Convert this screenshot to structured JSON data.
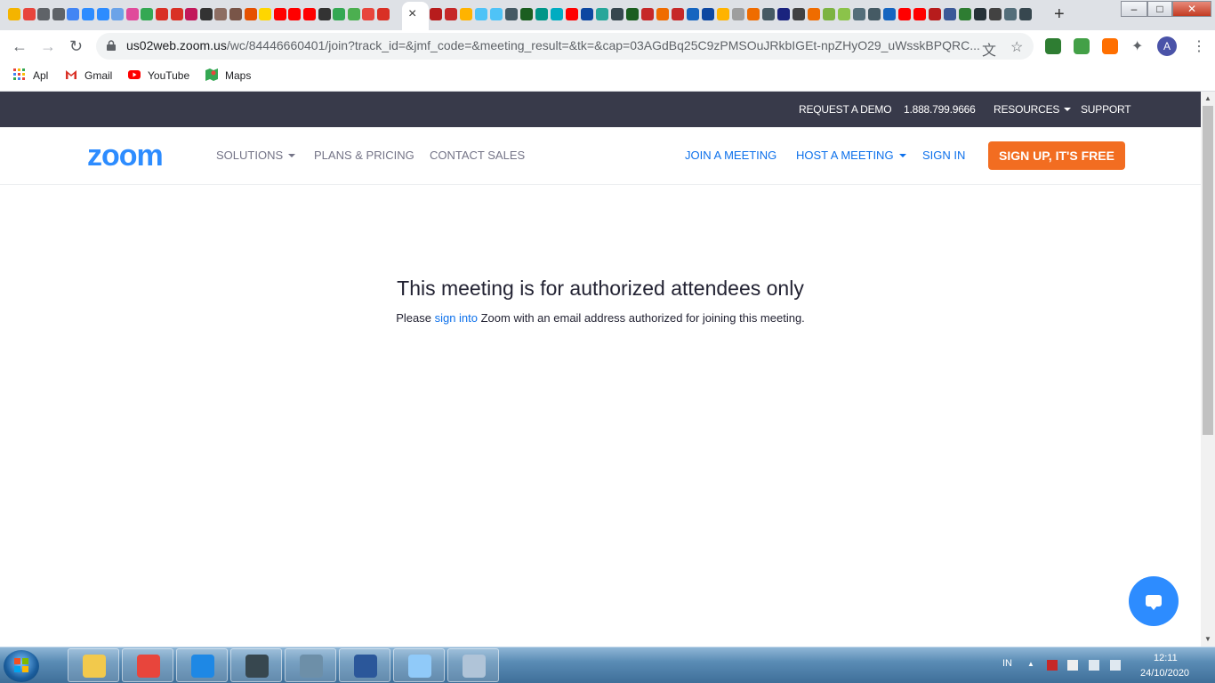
{
  "browser": {
    "tab_close": "×",
    "new_tab": "+",
    "window_controls": {
      "minimize": "‒",
      "maximize": "□",
      "close": "✕"
    },
    "nav": {
      "back": "←",
      "forward": "→",
      "reload": "↻"
    },
    "url_host": "us02web.zoom.us",
    "url_path": "/wc/84446660401/join?track_id=&jmf_code=&meeting_result=&tk=&cap=03AGdBq25C9zPMSOuJRkbIGEt-npZHyO29_uWsskBPQRC...",
    "profile_initial": "A",
    "menu": "⋮",
    "translate_icon": "文",
    "star_icon": "☆",
    "extensions_icon": "✦",
    "bookmarks": [
      {
        "label": "Apl",
        "color": "#e8453c"
      },
      {
        "label": "Gmail",
        "color": "#d93025"
      },
      {
        "label": "YouTube",
        "color": "#ff0000"
      },
      {
        "label": "Maps",
        "color": "#34a853"
      }
    ],
    "tab_icon_colors": [
      "#f4b400",
      "#e8453c",
      "#5f6368",
      "#5f6368",
      "#4285f4",
      "#2d8cff",
      "#2d8cff",
      "#6ba3e8",
      "#e04b9b",
      "#34a853",
      "#d93025",
      "#d93025",
      "#c2185b",
      "#333333",
      "#8d6e63",
      "#795548",
      "#e65100",
      "#ffd600",
      "#ff0000",
      "#ff0000",
      "#ff0000",
      "#333333",
      "#34a853",
      "#4caf50",
      "#e8453c",
      "#d93025"
    ],
    "tab_icon_colors_right": [
      "#b71c1c",
      "#c62828",
      "#ffb300",
      "#4fc3f7",
      "#4fc3f7",
      "#455a64",
      "#1b5e20",
      "#009688",
      "#00acc1",
      "#ff0000",
      "#0d47a1",
      "#26a69a",
      "#37474f",
      "#1b5e20",
      "#c62828",
      "#ef6c00",
      "#c62828",
      "#1565c0",
      "#0d47a1",
      "#ffb300",
      "#9e9e9e",
      "#ef6c00",
      "#455a64",
      "#1a237e",
      "#424242",
      "#ef6c00",
      "#7cb342",
      "#8bc34a",
      "#546e7a",
      "#455a64",
      "#1565c0",
      "#ff0000",
      "#ff0000",
      "#b71c1c",
      "#3b5998",
      "#2e7d32",
      "#263238",
      "#424242",
      "#546e7a",
      "#37474f"
    ],
    "ext_colors": [
      "#2e7d32",
      "#43a047",
      "#ff6f00"
    ]
  },
  "zoom": {
    "topbar": {
      "request_demo": "REQUEST A DEMO",
      "phone": "1.888.799.9666",
      "resources": "RESOURCES",
      "support": "SUPPORT"
    },
    "logo": "zoom",
    "nav": {
      "solutions": "SOLUTIONS",
      "plans": "PLANS & PRICING",
      "contact": "CONTACT SALES",
      "join": "JOIN A MEETING",
      "host": "HOST A MEETING",
      "signin": "SIGN IN",
      "signup": "SIGN UP, IT'S FREE"
    },
    "main": {
      "heading": "This meeting is for authorized attendees only",
      "text_before": "Please ",
      "link": "sign into",
      "text_after": " Zoom with an email address authorized for joining this meeting."
    },
    "colors": {
      "brand": "#2d8cff",
      "link": "#0e71eb",
      "cta": "#f26d21",
      "topbar": "#383a4a"
    }
  },
  "taskbar": {
    "items": [
      {
        "name": "explorer",
        "color": "#f2c94c"
      },
      {
        "name": "chrome",
        "color": "#e8453c"
      },
      {
        "name": "internet-explorer",
        "color": "#1e88e5"
      },
      {
        "name": "media-player-classic",
        "color": "#37474f"
      },
      {
        "name": "notepad-app",
        "color": "#6d8fa8"
      },
      {
        "name": "word",
        "color": "#2b579a"
      },
      {
        "name": "paint",
        "color": "#90caf9"
      },
      {
        "name": "sticky-app",
        "color": "#b0c4d8"
      }
    ],
    "language": "IN",
    "time": "12:11",
    "date": "24/10/2020",
    "show_hidden": "▲"
  }
}
